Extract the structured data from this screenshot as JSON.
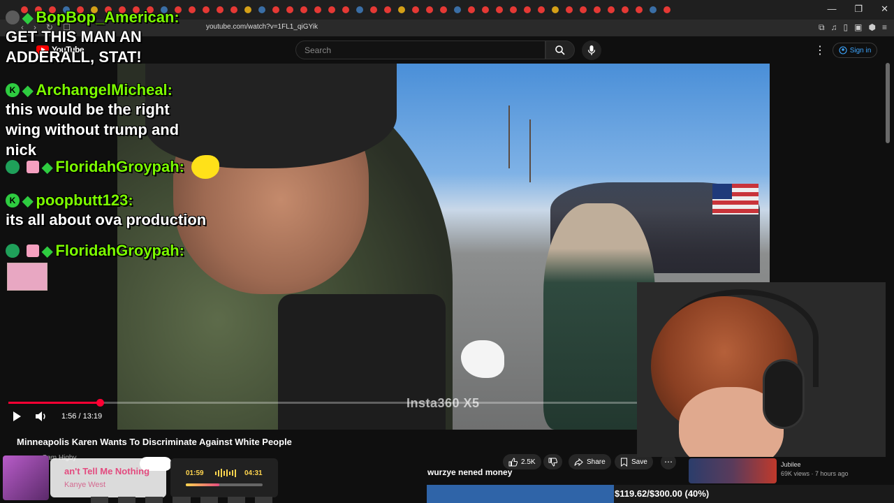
{
  "browser": {
    "url": "youtube.com/watch?v=1FL1_qiGYik",
    "win_min": "—",
    "win_max": "❐",
    "win_close": "✕"
  },
  "youtube": {
    "logo_text": "YouTube",
    "search_placeholder": "Search",
    "sign_in": "Sign in"
  },
  "player": {
    "current_time": "1:56",
    "duration": "13:19",
    "time_label": "1:56 / 13:19",
    "progress_fraction": 0.145,
    "watermark": "Insta360 X5"
  },
  "video_info": {
    "title": "Minneapolis Karen Wants To Discriminate Against White People",
    "channel": "Cam Higby",
    "like_count": "2.5K",
    "share_label": "Share",
    "save_label": "Save"
  },
  "recommendation": {
    "title": "Jubilee",
    "meta": "69K views · 7 hours ago"
  },
  "chat": [
    {
      "user": "BopBop_American:",
      "badges": [
        "gem"
      ],
      "text": "GET THIS MAN AN ADDERALL, STAT!"
    },
    {
      "user": "ArchangelMicheal:",
      "badges": [
        "k",
        "gem"
      ],
      "text": "this would be the right wing without trump and nick"
    },
    {
      "user": "FloridahGroypah:",
      "badges": [
        "heart",
        "gift",
        "gem"
      ],
      "text": ""
    },
    {
      "user": "poopbutt123:",
      "badges": [
        "k",
        "gem"
      ],
      "text": "its all about ova production"
    },
    {
      "user": "FloridahGroypah:",
      "badges": [
        "heart",
        "gift",
        "gem"
      ],
      "text": ""
    }
  ],
  "music": {
    "song": "Can't Tell Me Nothing",
    "song_visible": "an't Tell Me Nothing",
    "artist": "Kanye West",
    "elapsed": "01:59",
    "total": "04:31",
    "progress_fraction": 0.44
  },
  "caption": "wurzye nened money",
  "goal": {
    "text": "$119.62/$300.00 (40%)",
    "fraction": 0.4
  },
  "colors": {
    "chat_username": "#7cfc00",
    "yt_red": "#ff0033",
    "goal_fill": "#2f64a8",
    "song_pink": "#e34b7f"
  }
}
